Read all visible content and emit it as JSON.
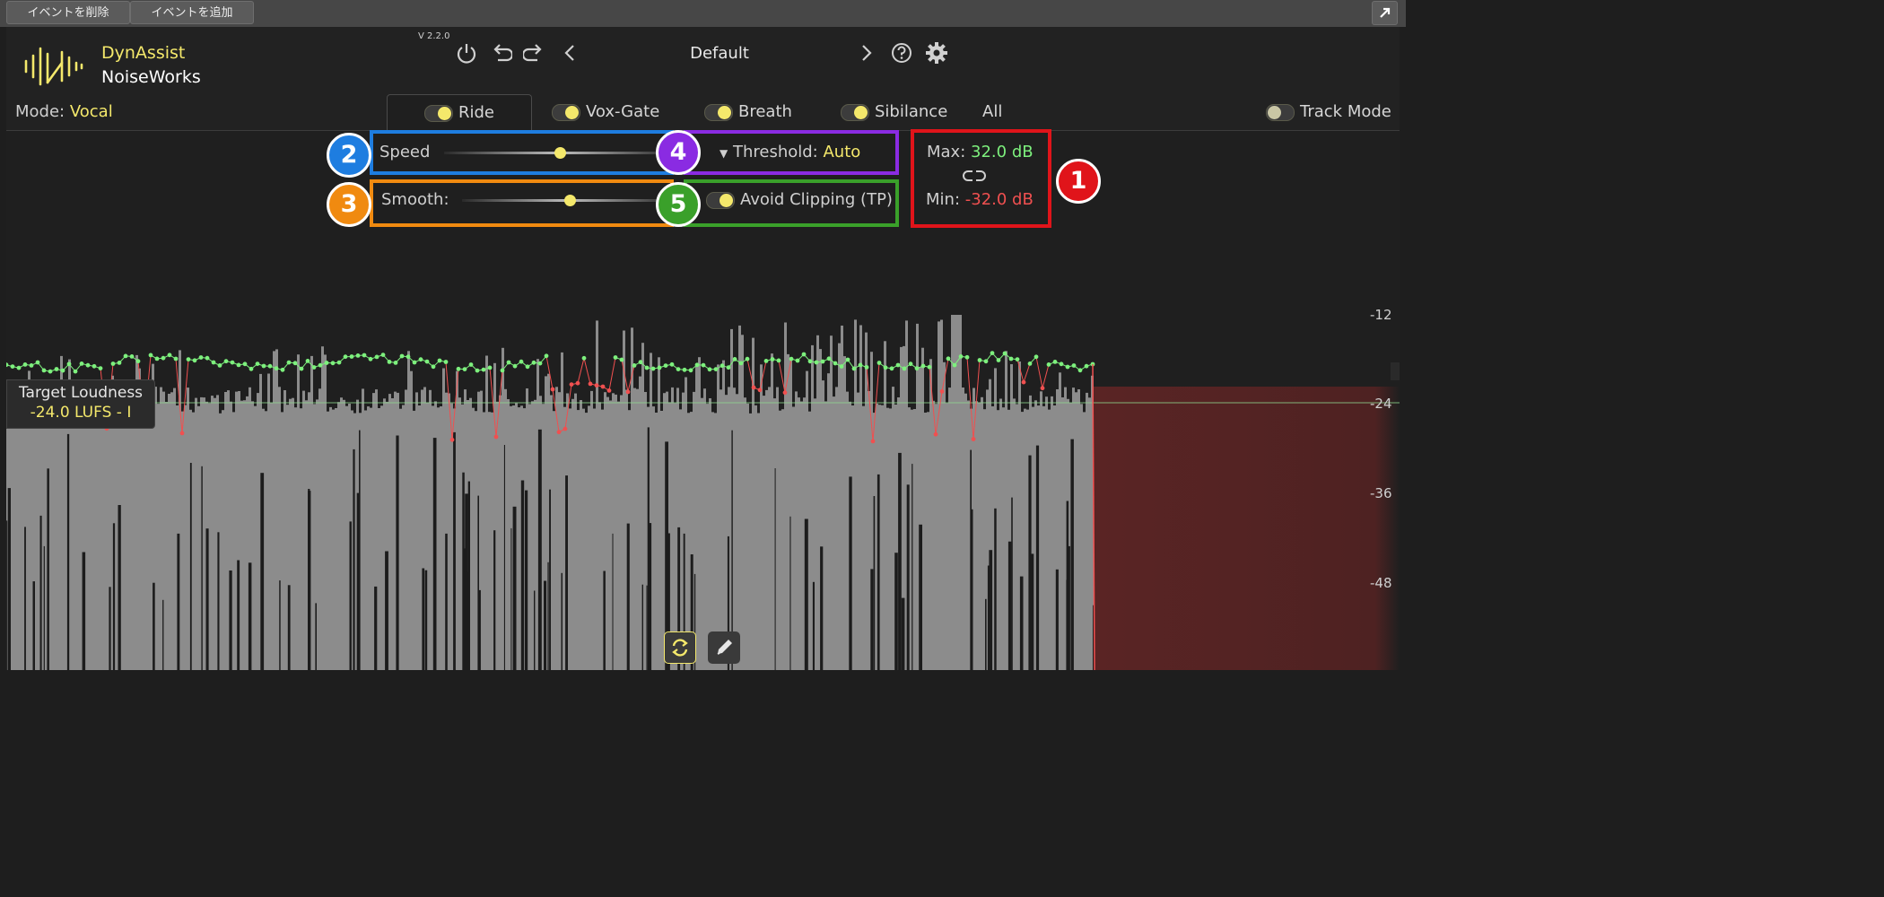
{
  "host": {
    "delete_event": "イベントを削除",
    "add_event": "イベントを追加"
  },
  "plugin": {
    "name": "DynAssist",
    "vendor": "NoiseWorks",
    "version": "V 2.2.0",
    "preset": "Default",
    "mode_label": "Mode:",
    "mode_value": "Vocal"
  },
  "tabs": [
    {
      "label": "Ride",
      "enabled": true,
      "active": true
    },
    {
      "label": "Vox-Gate",
      "enabled": true,
      "active": false
    },
    {
      "label": "Breath",
      "enabled": true,
      "active": false
    },
    {
      "label": "Sibilance",
      "enabled": true,
      "active": false
    },
    {
      "label": "All",
      "active": false
    }
  ],
  "track_mode": {
    "label": "Track Mode",
    "enabled": false
  },
  "controls": {
    "speed": {
      "label": "Speed",
      "value": 0.56
    },
    "smooth": {
      "label": "Smooth:",
      "value": 0.54
    },
    "threshold": {
      "label": "Threshold:",
      "value": "Auto"
    },
    "avoid_clipping": {
      "label": "Avoid Clipping (TP)",
      "enabled": true
    },
    "max": {
      "label": "Max:",
      "value": "32.0 dB"
    },
    "min": {
      "label": "Min:",
      "value": "-32.0 dB"
    },
    "link_icon": "link-icon"
  },
  "annotations": [
    {
      "number": "1",
      "color": "#e0141a",
      "target": "max-min-range"
    },
    {
      "number": "2",
      "color": "#1e7de0",
      "target": "speed"
    },
    {
      "number": "3",
      "color": "#f08a10",
      "target": "smooth"
    },
    {
      "number": "4",
      "color": "#8a2be2",
      "target": "threshold"
    },
    {
      "number": "5",
      "color": "#3aa02a",
      "target": "avoid-clipping"
    }
  ],
  "scale": [
    "-12",
    "-24",
    "-36",
    "-48"
  ],
  "target_loudness": {
    "label": "Target Loudness",
    "value": "-24.0 LUFS - I"
  },
  "colors": {
    "accent_yellow": "#f4e86b",
    "gain_up_green": "#7df07d",
    "gain_down_red": "#f05050",
    "waveform_gray": "#8c8c8c",
    "clip_region": "#5a2424"
  },
  "bottom_icons": [
    "loop-icon",
    "pencil-icon"
  ]
}
